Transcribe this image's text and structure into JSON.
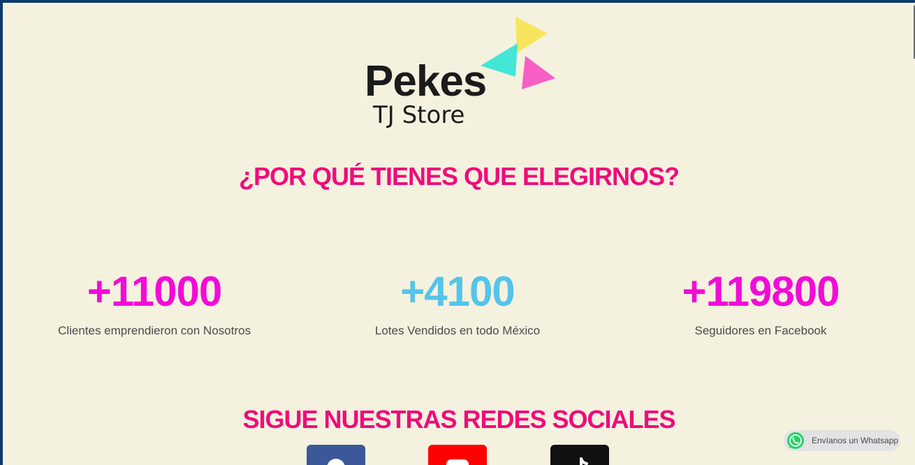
{
  "brand": {
    "line1": "Pekes",
    "line2": "TJ Store"
  },
  "why": {
    "title": "¿POR QUÉ TIENES QUE ELEGIRNOS?"
  },
  "stats": [
    {
      "value": "+11000",
      "label": "Clientes emprendieron con Nosotros",
      "color": "#f20bd6"
    },
    {
      "value": "+4100",
      "label": "Lotes Vendidos en todo México",
      "color": "#55c4e8"
    },
    {
      "value": "+119800",
      "label": "Seguidores en Facebook",
      "color": "#f20bd6"
    }
  ],
  "social": {
    "title": "SIGUE NUESTRAS REDES SOCIALES",
    "buttons": [
      {
        "icon": "facebook-icon",
        "color": "#3b5998"
      },
      {
        "icon": "youtube-icon",
        "color": "#ff0000"
      },
      {
        "icon": "tiktok-icon",
        "color": "#111111"
      }
    ]
  },
  "whatsapp": {
    "label": "Envíanos un Whatsapp",
    "color": "#25d366"
  },
  "colors": {
    "accent": "#ef0b7a",
    "background": "#f5f1df",
    "frame": "#0b3a6e"
  }
}
